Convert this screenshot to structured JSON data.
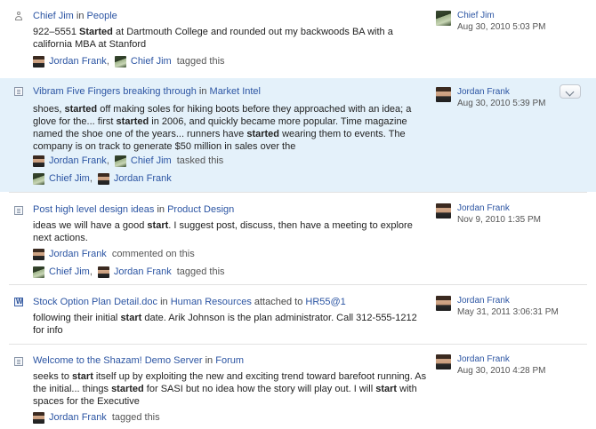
{
  "feed": [
    {
      "type_icon": "person-icon",
      "title_link": "Chief Jim",
      "title_sep": "in",
      "title_place": "People",
      "snippet_parts": [
        [
          "",
          "922–5551 "
        ],
        [
          "b",
          "Started"
        ],
        [
          "",
          " at Dartmouth College and rounded out my backwoods BA with a california MBA at Stanford"
        ]
      ],
      "activities": [
        {
          "actors": [
            "Jordan Frank",
            "Chief Jim"
          ],
          "verb": "tagged this"
        }
      ],
      "author": {
        "name": "Chief Jim",
        "date": "Aug 30, 2010 5:03 PM"
      }
    },
    {
      "type_icon": "document-icon",
      "title_link": "Vibram Five Fingers breaking through",
      "title_sep": "in",
      "title_place": "Market Intel",
      "snippet_parts": [
        [
          "",
          "shoes, "
        ],
        [
          "b",
          "started"
        ],
        [
          "",
          " off making soles for hiking boots before they approached with an idea; a glove for the... first "
        ],
        [
          "b",
          "started"
        ],
        [
          "",
          " in 2006, and quickly became more popular. Time magazine named the shoe one of the years... runners have "
        ],
        [
          "b",
          "started"
        ],
        [
          "",
          " wearing them to events. The company is on track to generate $50 million in sales over the"
        ]
      ],
      "activities": [
        {
          "actors": [
            "Jordan Frank",
            "Chief Jim"
          ],
          "verb": "tasked this"
        },
        {
          "actors": [
            "Chief Jim",
            "Jordan Frank"
          ],
          "verb": ""
        }
      ],
      "author": {
        "name": "Jordan Frank",
        "date": "Aug 30, 2010 5:39 PM"
      },
      "menu_icon": "chevron-down-icon"
    },
    {
      "type_icon": "document-icon",
      "title_link": "Post high level design ideas",
      "title_sep": "in",
      "title_place": "Product Design",
      "snippet_parts": [
        [
          "",
          "ideas we will have a good "
        ],
        [
          "b",
          "start"
        ],
        [
          "",
          ". I suggest post, discuss, then have a meeting to explore next actions."
        ]
      ],
      "activities": [
        {
          "actors": [
            "Jordan Frank"
          ],
          "verb": "commented on this"
        },
        {
          "actors": [
            "Chief Jim",
            "Jordan Frank"
          ],
          "verb": "tagged this"
        }
      ],
      "author": {
        "name": "Jordan Frank",
        "date": "Nov 9, 2010 1:35 PM"
      }
    },
    {
      "type_icon": "word-doc-icon",
      "title_link": "Stock Option Plan Detail.doc",
      "title_sep": "in",
      "title_place": "Human Resources",
      "title_extra_text": "attached to",
      "title_extra_link": "HR55@1",
      "snippet_parts": [
        [
          "",
          "following their initial "
        ],
        [
          "b",
          "start"
        ],
        [
          "",
          " date. Arik Johnson is the plan administrator. Call 312-555-1212 for info"
        ]
      ],
      "activities": [],
      "author": {
        "name": "Jordan Frank",
        "date": "May 31, 2011 3:06:31 PM"
      }
    },
    {
      "type_icon": "document-icon",
      "title_link": "Welcome to the Shazam! Demo Server",
      "title_sep": "in",
      "title_place": "Forum",
      "snippet_parts": [
        [
          "",
          "seeks to "
        ],
        [
          "b",
          "start"
        ],
        [
          "",
          " itself up by exploiting the new and exciting trend toward barefoot running. As the initial... things "
        ],
        [
          "b",
          "started"
        ],
        [
          "",
          " for SASI but no idea how the story will play out. I will "
        ],
        [
          "b",
          "start"
        ],
        [
          "",
          " with spaces for the Executive"
        ]
      ],
      "activities": [
        {
          "actors": [
            "Jordan Frank"
          ],
          "verb": "tagged this"
        }
      ],
      "author": {
        "name": "Jordan Frank",
        "date": "Aug 30, 2010 4:28 PM"
      }
    }
  ]
}
